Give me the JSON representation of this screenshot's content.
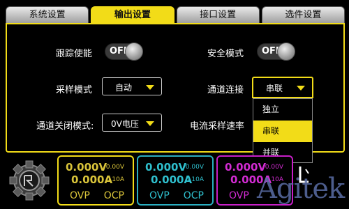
{
  "tabs": [
    {
      "label": "系统设置"
    },
    {
      "label": "输出设置"
    },
    {
      "label": "接口设置"
    },
    {
      "label": "选件设置"
    }
  ],
  "form": {
    "tracking_enable": {
      "label": "跟踪使能",
      "state": "OFF"
    },
    "safety_mode": {
      "label": "安全模式",
      "state": "OFF"
    },
    "sampling_mode": {
      "label": "采样模式",
      "value": "自动"
    },
    "channel_connect": {
      "label": "通道连接",
      "value": "串联"
    },
    "channel_off_mode": {
      "label": "通道关闭模式:",
      "value": "0V电压"
    },
    "current_sampling_rate": {
      "label": "电流采样速率"
    }
  },
  "dropdown": {
    "options": [
      {
        "label": "独立",
        "selected": false
      },
      {
        "label": "串联",
        "selected": true
      },
      {
        "label": "并联",
        "selected": false
      }
    ]
  },
  "channels": [
    {
      "voltage": "0.000V",
      "voltage_set": "0.00V",
      "current": "0.000A",
      "current_set": "0.10A",
      "ovp": "OVP",
      "ocp": "OCP",
      "color": "#f2dc18"
    },
    {
      "voltage": "0.000V",
      "voltage_set": "0.00V",
      "current": "0.000A",
      "current_set": "0.10A",
      "ovp": "OVP",
      "ocp": "OCP",
      "color": "#2aaec0"
    },
    {
      "voltage": "0.000V",
      "voltage_set": "0.00V",
      "current": "0.000A",
      "current_set": "0.10A",
      "ovp": "OVP",
      "ocp": "",
      "color": "#c81fc8"
    }
  ],
  "branding": {
    "watermark": "Agitek"
  },
  "colors": {
    "accent": "#f2dc18",
    "background": "#000000"
  }
}
